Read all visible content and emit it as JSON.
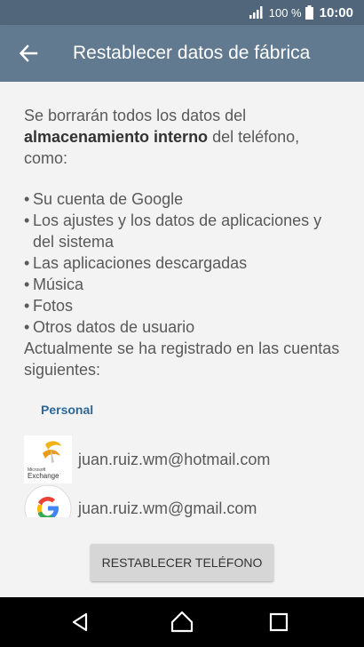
{
  "status_bar": {
    "battery_percent": "100 %",
    "time": "10:00"
  },
  "app_bar": {
    "title": "Restablecer datos de fábrica",
    "back_icon": "arrow-left-icon"
  },
  "content": {
    "intro_before": "Se borrarán todos los datos del ",
    "intro_bold": "almacenamiento interno",
    "intro_after": " del teléfono, como:",
    "bullets": [
      "Su cuenta de Google",
      "Los ajustes y los datos de aplicaciones y del sistema",
      "Las aplicaciones descargadas",
      "Música",
      "Fotos",
      "Otros datos de usuario"
    ],
    "registered": "Actualmente se ha registrado en las cuentas siguientes:",
    "section_label": "Personal",
    "accounts": [
      {
        "email": "juan.ruiz.wm@hotmail.com",
        "icon": "microsoft-exchange-icon",
        "icon_text_top": "Microsoft",
        "icon_text_bottom": "Exchange"
      },
      {
        "email": "juan.ruiz.wm@gmail.com",
        "icon": "google-icon"
      }
    ]
  },
  "footer": {
    "reset_button": "RESTABLECER TELÉFONO"
  },
  "colors": {
    "status_bar": "#51667a",
    "app_bar": "#617a90",
    "accent": "#2f6796",
    "background": "#f3f3f3"
  }
}
